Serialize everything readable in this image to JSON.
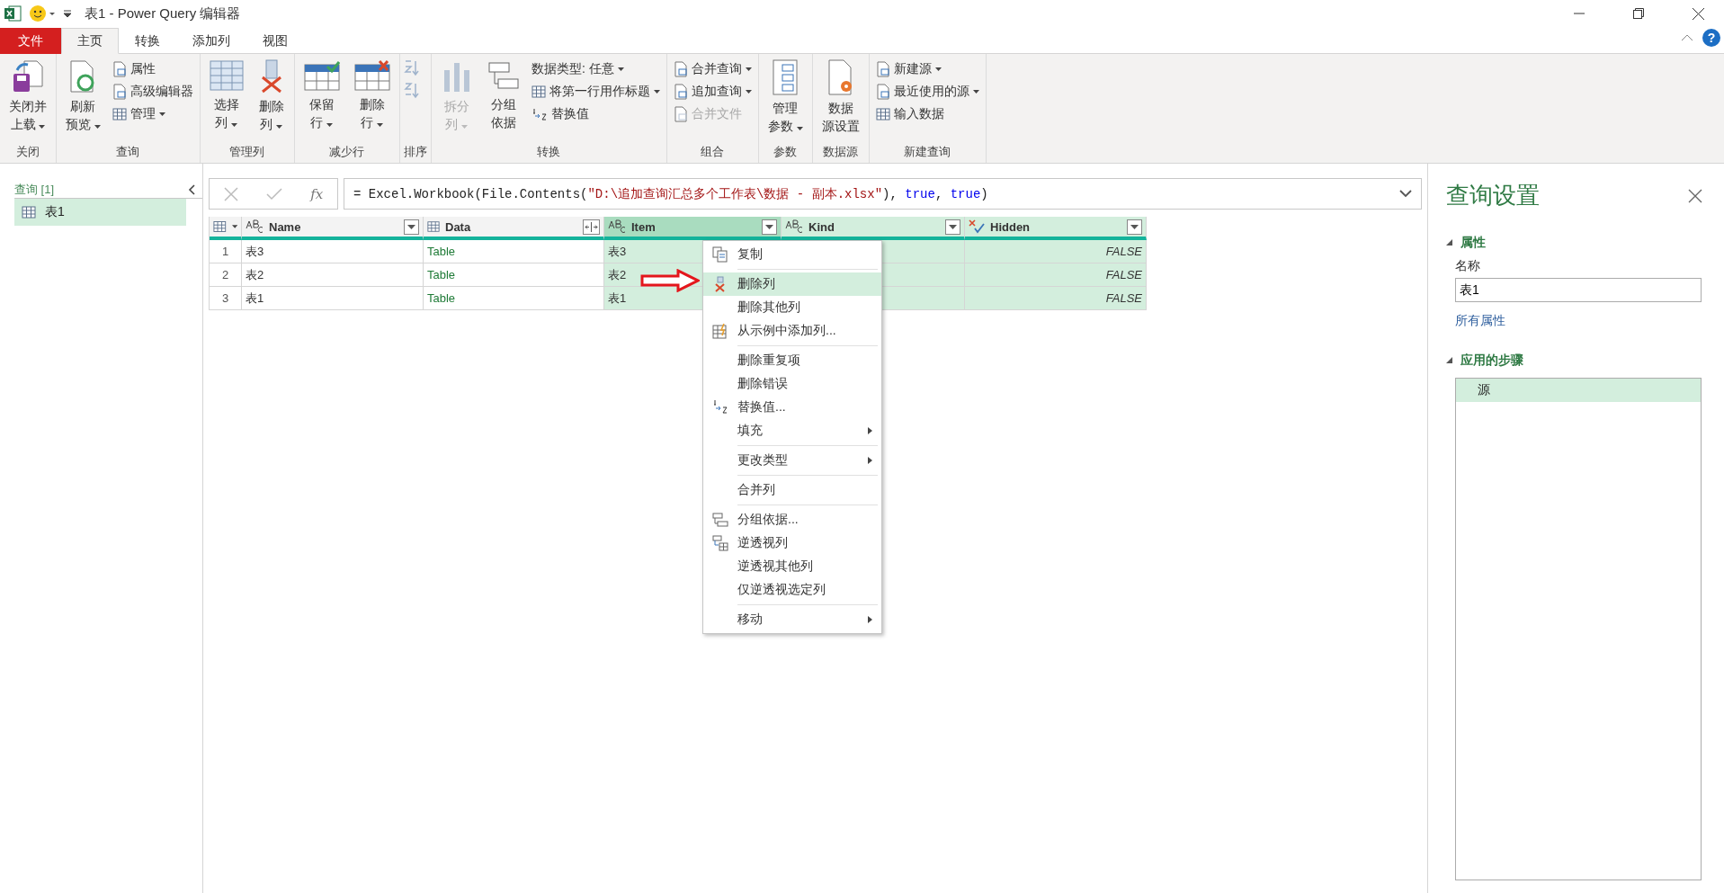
{
  "title_bar": {
    "title": "表1 - Power Query 编辑器",
    "help": "?"
  },
  "tabs": [
    {
      "label": "文件",
      "kind": "file",
      "selected": false
    },
    {
      "label": "主页",
      "kind": "tab",
      "selected": true
    },
    {
      "label": "转换",
      "kind": "tab",
      "selected": false
    },
    {
      "label": "添加列",
      "kind": "tab",
      "selected": false
    },
    {
      "label": "视图",
      "kind": "tab",
      "selected": false
    }
  ],
  "ribbon": {
    "groups": [
      {
        "label": "关闭",
        "items": [
          {
            "kind": "large",
            "lines": [
              "关闭并",
              "上载"
            ],
            "dropdown": true,
            "disabled": false
          }
        ]
      },
      {
        "label": "查询",
        "items": [
          {
            "kind": "large",
            "lines": [
              "刷新",
              "预览"
            ],
            "dropdown": true,
            "disabled": false
          },
          {
            "kind": "stack",
            "items": [
              {
                "label": "属性",
                "dropdown": false,
                "disabled": false
              },
              {
                "label": "高级编辑器",
                "dropdown": false,
                "disabled": false
              },
              {
                "label": "管理",
                "dropdown": true,
                "disabled": false
              }
            ]
          }
        ]
      },
      {
        "label": "管理列",
        "items": [
          {
            "kind": "large",
            "lines": [
              "选择",
              "列"
            ],
            "dropdown": true,
            "disabled": false
          },
          {
            "kind": "large",
            "lines": [
              "删除",
              "列"
            ],
            "dropdown": true,
            "disabled": false
          }
        ]
      },
      {
        "label": "减少行",
        "items": [
          {
            "kind": "large",
            "lines": [
              "保留",
              "行"
            ],
            "dropdown": true,
            "disabled": false
          },
          {
            "kind": "large",
            "lines": [
              "删除",
              "行"
            ],
            "dropdown": true,
            "disabled": false
          }
        ]
      },
      {
        "label": "排序",
        "items": [
          {
            "kind": "sort",
            "disabled": true
          }
        ]
      },
      {
        "label": "转换",
        "items": [
          {
            "kind": "large",
            "lines": [
              "拆分",
              "列"
            ],
            "dropdown": true,
            "disabled": true
          },
          {
            "kind": "large",
            "lines": [
              "分组",
              "依据"
            ],
            "dropdown": false,
            "disabled": false
          },
          {
            "kind": "stack",
            "items": [
              {
                "label": "数据类型: 任意",
                "dropdown": true,
                "disabled": false
              },
              {
                "label": "将第一行用作标题",
                "dropdown": true,
                "disabled": false
              },
              {
                "label": "替换值",
                "dropdown": false,
                "disabled": false
              }
            ]
          }
        ]
      },
      {
        "label": "组合",
        "items": [
          {
            "kind": "stack",
            "items": [
              {
                "label": "合并查询",
                "dropdown": true,
                "disabled": false
              },
              {
                "label": "追加查询",
                "dropdown": true,
                "disabled": false
              },
              {
                "label": "合并文件",
                "dropdown": false,
                "disabled": true
              }
            ]
          }
        ]
      },
      {
        "label": "参数",
        "items": [
          {
            "kind": "large",
            "lines": [
              "管理",
              "参数"
            ],
            "dropdown": true,
            "disabled": false
          }
        ]
      },
      {
        "label": "数据源",
        "items": [
          {
            "kind": "large",
            "lines": [
              "数据",
              "源设置"
            ],
            "dropdown": false,
            "disabled": false
          }
        ]
      },
      {
        "label": "新建查询",
        "items": [
          {
            "kind": "stack",
            "items": [
              {
                "label": "新建源",
                "dropdown": true,
                "disabled": false
              },
              {
                "label": "最近使用的源",
                "dropdown": true,
                "disabled": false
              },
              {
                "label": "输入数据",
                "dropdown": false,
                "disabled": false
              }
            ]
          }
        ]
      }
    ]
  },
  "queries_pane": {
    "header": "查询 [1]",
    "items": [
      {
        "label": "表1",
        "selected": true
      }
    ]
  },
  "formula_bar": {
    "fx_label": "fx",
    "tokens": [
      {
        "text": "= Excel.Workbook(File.Contents(",
        "kind": "plain"
      },
      {
        "text": "\"D:\\追加查询汇总多个工作表\\数据 - 副本.xlsx\"",
        "kind": "string"
      },
      {
        "text": "), ",
        "kind": "plain"
      },
      {
        "text": "true",
        "kind": "keyword"
      },
      {
        "text": ", ",
        "kind": "plain"
      },
      {
        "text": "true",
        "kind": "keyword"
      },
      {
        "text": ")",
        "kind": "plain"
      }
    ]
  },
  "table": {
    "columns": [
      {
        "name": "Name",
        "kind": "text",
        "selected": false,
        "active": false
      },
      {
        "name": "Data",
        "kind": "table",
        "selected": false,
        "active": false
      },
      {
        "name": "Item",
        "kind": "text",
        "selected": true,
        "active": true
      },
      {
        "name": "Kind",
        "kind": "text",
        "selected": true,
        "active": false
      },
      {
        "name": "Hidden",
        "kind": "logical",
        "selected": true,
        "active": false
      }
    ],
    "rows": [
      {
        "number": "1",
        "cells": [
          "表3",
          "Table",
          "表3",
          null,
          "FALSE"
        ]
      },
      {
        "number": "2",
        "cells": [
          "表2",
          "Table",
          "表2",
          null,
          "FALSE"
        ]
      },
      {
        "number": "3",
        "cells": [
          "表1",
          "Table",
          "表1",
          null,
          "FALSE"
        ]
      }
    ]
  },
  "context_menu": {
    "sections": [
      [
        {
          "label": "复制",
          "submenu": false,
          "selected": false
        }
      ],
      [
        {
          "label": "删除列",
          "submenu": false,
          "selected": true
        },
        {
          "label": "删除其他列",
          "submenu": false,
          "selected": false
        },
        {
          "label": "从示例中添加列...",
          "submenu": false,
          "selected": false
        }
      ],
      [
        {
          "label": "删除重复项",
          "submenu": false,
          "selected": false
        },
        {
          "label": "删除错误",
          "submenu": false,
          "selected": false
        },
        {
          "label": "替换值...",
          "submenu": false,
          "selected": false
        },
        {
          "label": "填充",
          "submenu": true,
          "selected": false
        }
      ],
      [
        {
          "label": "更改类型",
          "submenu": true,
          "selected": false
        }
      ],
      [
        {
          "label": "合并列",
          "submenu": false,
          "selected": false
        }
      ],
      [
        {
          "label": "分组依据...",
          "submenu": false,
          "selected": false
        },
        {
          "label": "逆透视列",
          "submenu": false,
          "selected": false
        },
        {
          "label": "逆透视其他列",
          "submenu": false,
          "selected": false
        },
        {
          "label": "仅逆透视选定列",
          "submenu": false,
          "selected": false
        }
      ],
      [
        {
          "label": "移动",
          "submenu": true,
          "selected": false
        }
      ]
    ]
  },
  "settings_pane": {
    "title": "查询设置",
    "properties": {
      "heading": "属性",
      "expanded": true,
      "name_label": "名称",
      "name_value": "表1",
      "all_properties_link": "所有属性"
    },
    "steps": {
      "heading": "应用的步骤",
      "expanded": true,
      "items": [
        {
          "label": "源",
          "selected": true
        }
      ]
    }
  }
}
